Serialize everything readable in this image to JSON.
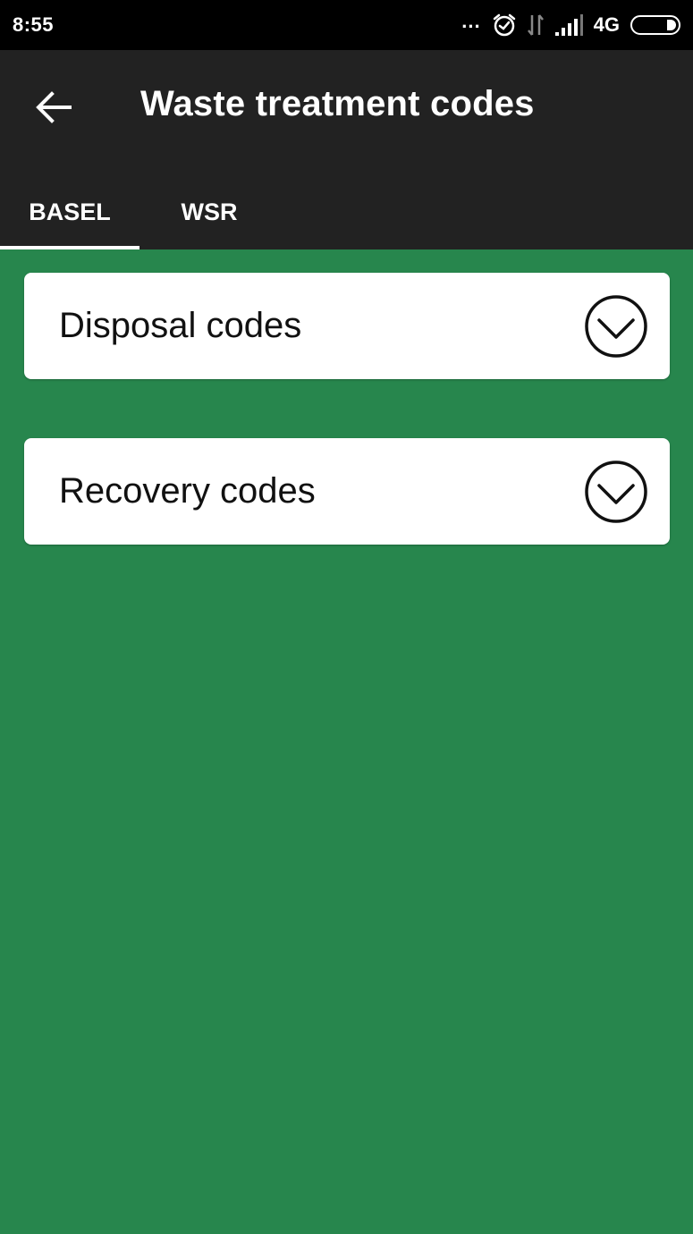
{
  "status_bar": {
    "time": "8:55",
    "more": "...",
    "network": "4G",
    "icons": [
      "alarm-icon",
      "data-transfer-icon",
      "signal-icon",
      "battery-icon"
    ]
  },
  "app_bar": {
    "back_icon": "arrow-left-icon",
    "title": "Waste treatment codes"
  },
  "tabs": [
    {
      "label": "BASEL",
      "selected": true
    },
    {
      "label": "WSR",
      "selected": false
    }
  ],
  "sections": [
    {
      "label": "Disposal codes",
      "icon": "chevron-down-circle-icon",
      "expanded": false
    },
    {
      "label": "Recovery codes",
      "icon": "chevron-down-circle-icon",
      "expanded": false
    }
  ],
  "colors": {
    "content_background": "#27864d",
    "app_bar": "#222222",
    "status_bar": "#000000",
    "card": "#ffffff"
  }
}
